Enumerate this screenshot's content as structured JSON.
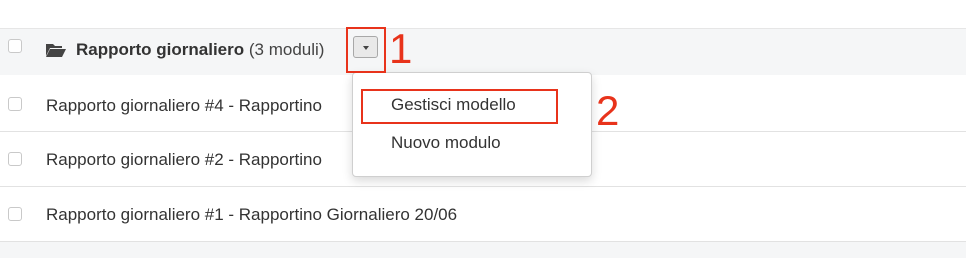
{
  "group": {
    "title": "Rapporto giornaliero",
    "count": "(3 moduli)"
  },
  "rows": [
    {
      "label": "Rapporto giornaliero #4 - Rapportino"
    },
    {
      "label": "Rapporto giornaliero #2 - Rapportino"
    },
    {
      "label": "Rapporto giornaliero #1 - Rapportino Giornaliero 20/06"
    }
  ],
  "dropdown": {
    "items": [
      {
        "label": "Gestisci modello"
      },
      {
        "label": "Nuovo modulo"
      }
    ]
  },
  "annotations": {
    "callout_1": "1",
    "callout_2": "2",
    "color": "#e8331b"
  },
  "icons": {
    "group": "folder-open-icon",
    "toggle": "caret-down-icon"
  }
}
